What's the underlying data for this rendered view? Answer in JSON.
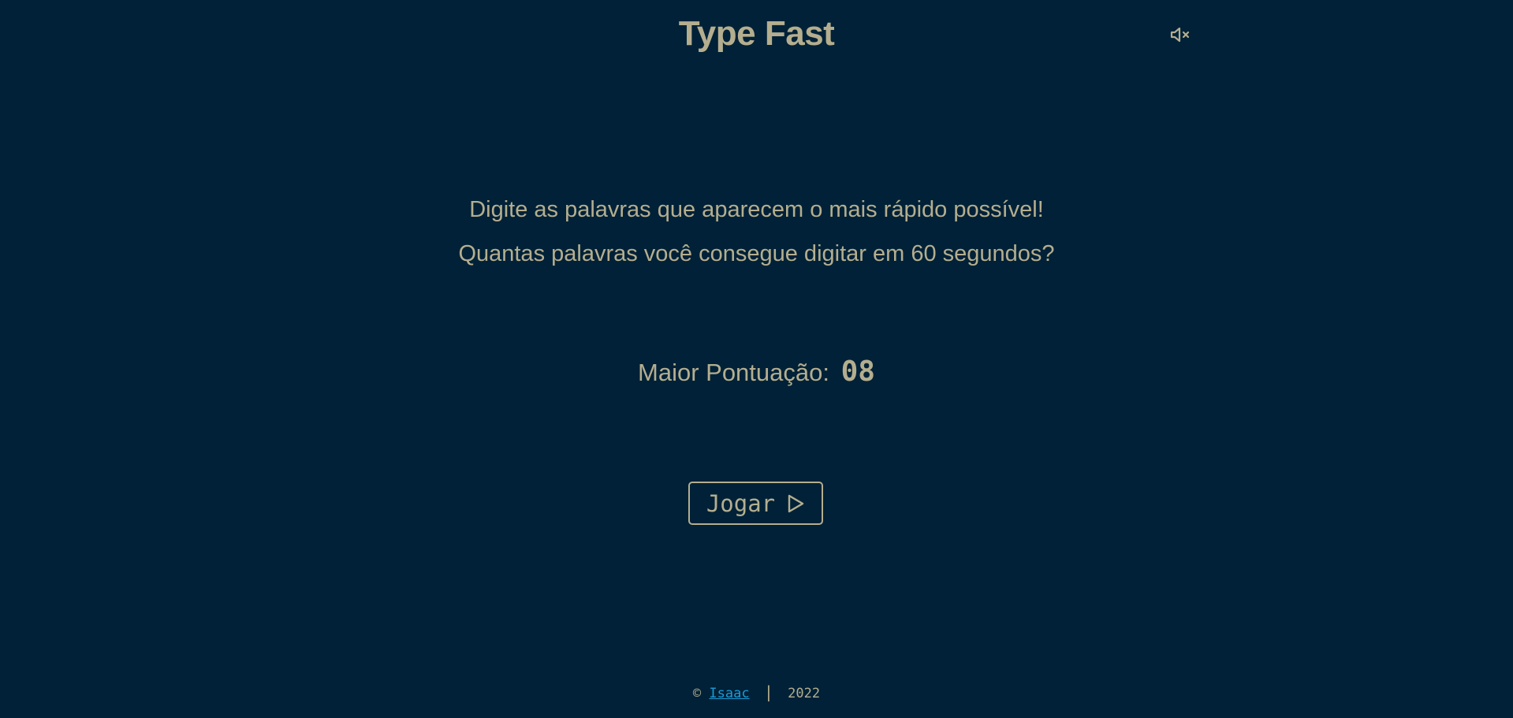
{
  "header": {
    "title": "Type Fast",
    "mute_icon": "speaker-muted-icon"
  },
  "intro": {
    "line1": "Digite as palavras que aparecem o mais rápido possível!",
    "line2": "Quantas palavras você consegue digitar em 60 segundos?"
  },
  "score": {
    "label": "Maior Pontuação:",
    "value": "08"
  },
  "play": {
    "label": "Jogar",
    "icon": "play-icon"
  },
  "footer": {
    "copyright": "©",
    "author": "Isaac",
    "separator": "|",
    "year": "2022"
  },
  "colors": {
    "background": "#002137",
    "text": "#b4ae8f",
    "link": "#1d9bd6"
  }
}
